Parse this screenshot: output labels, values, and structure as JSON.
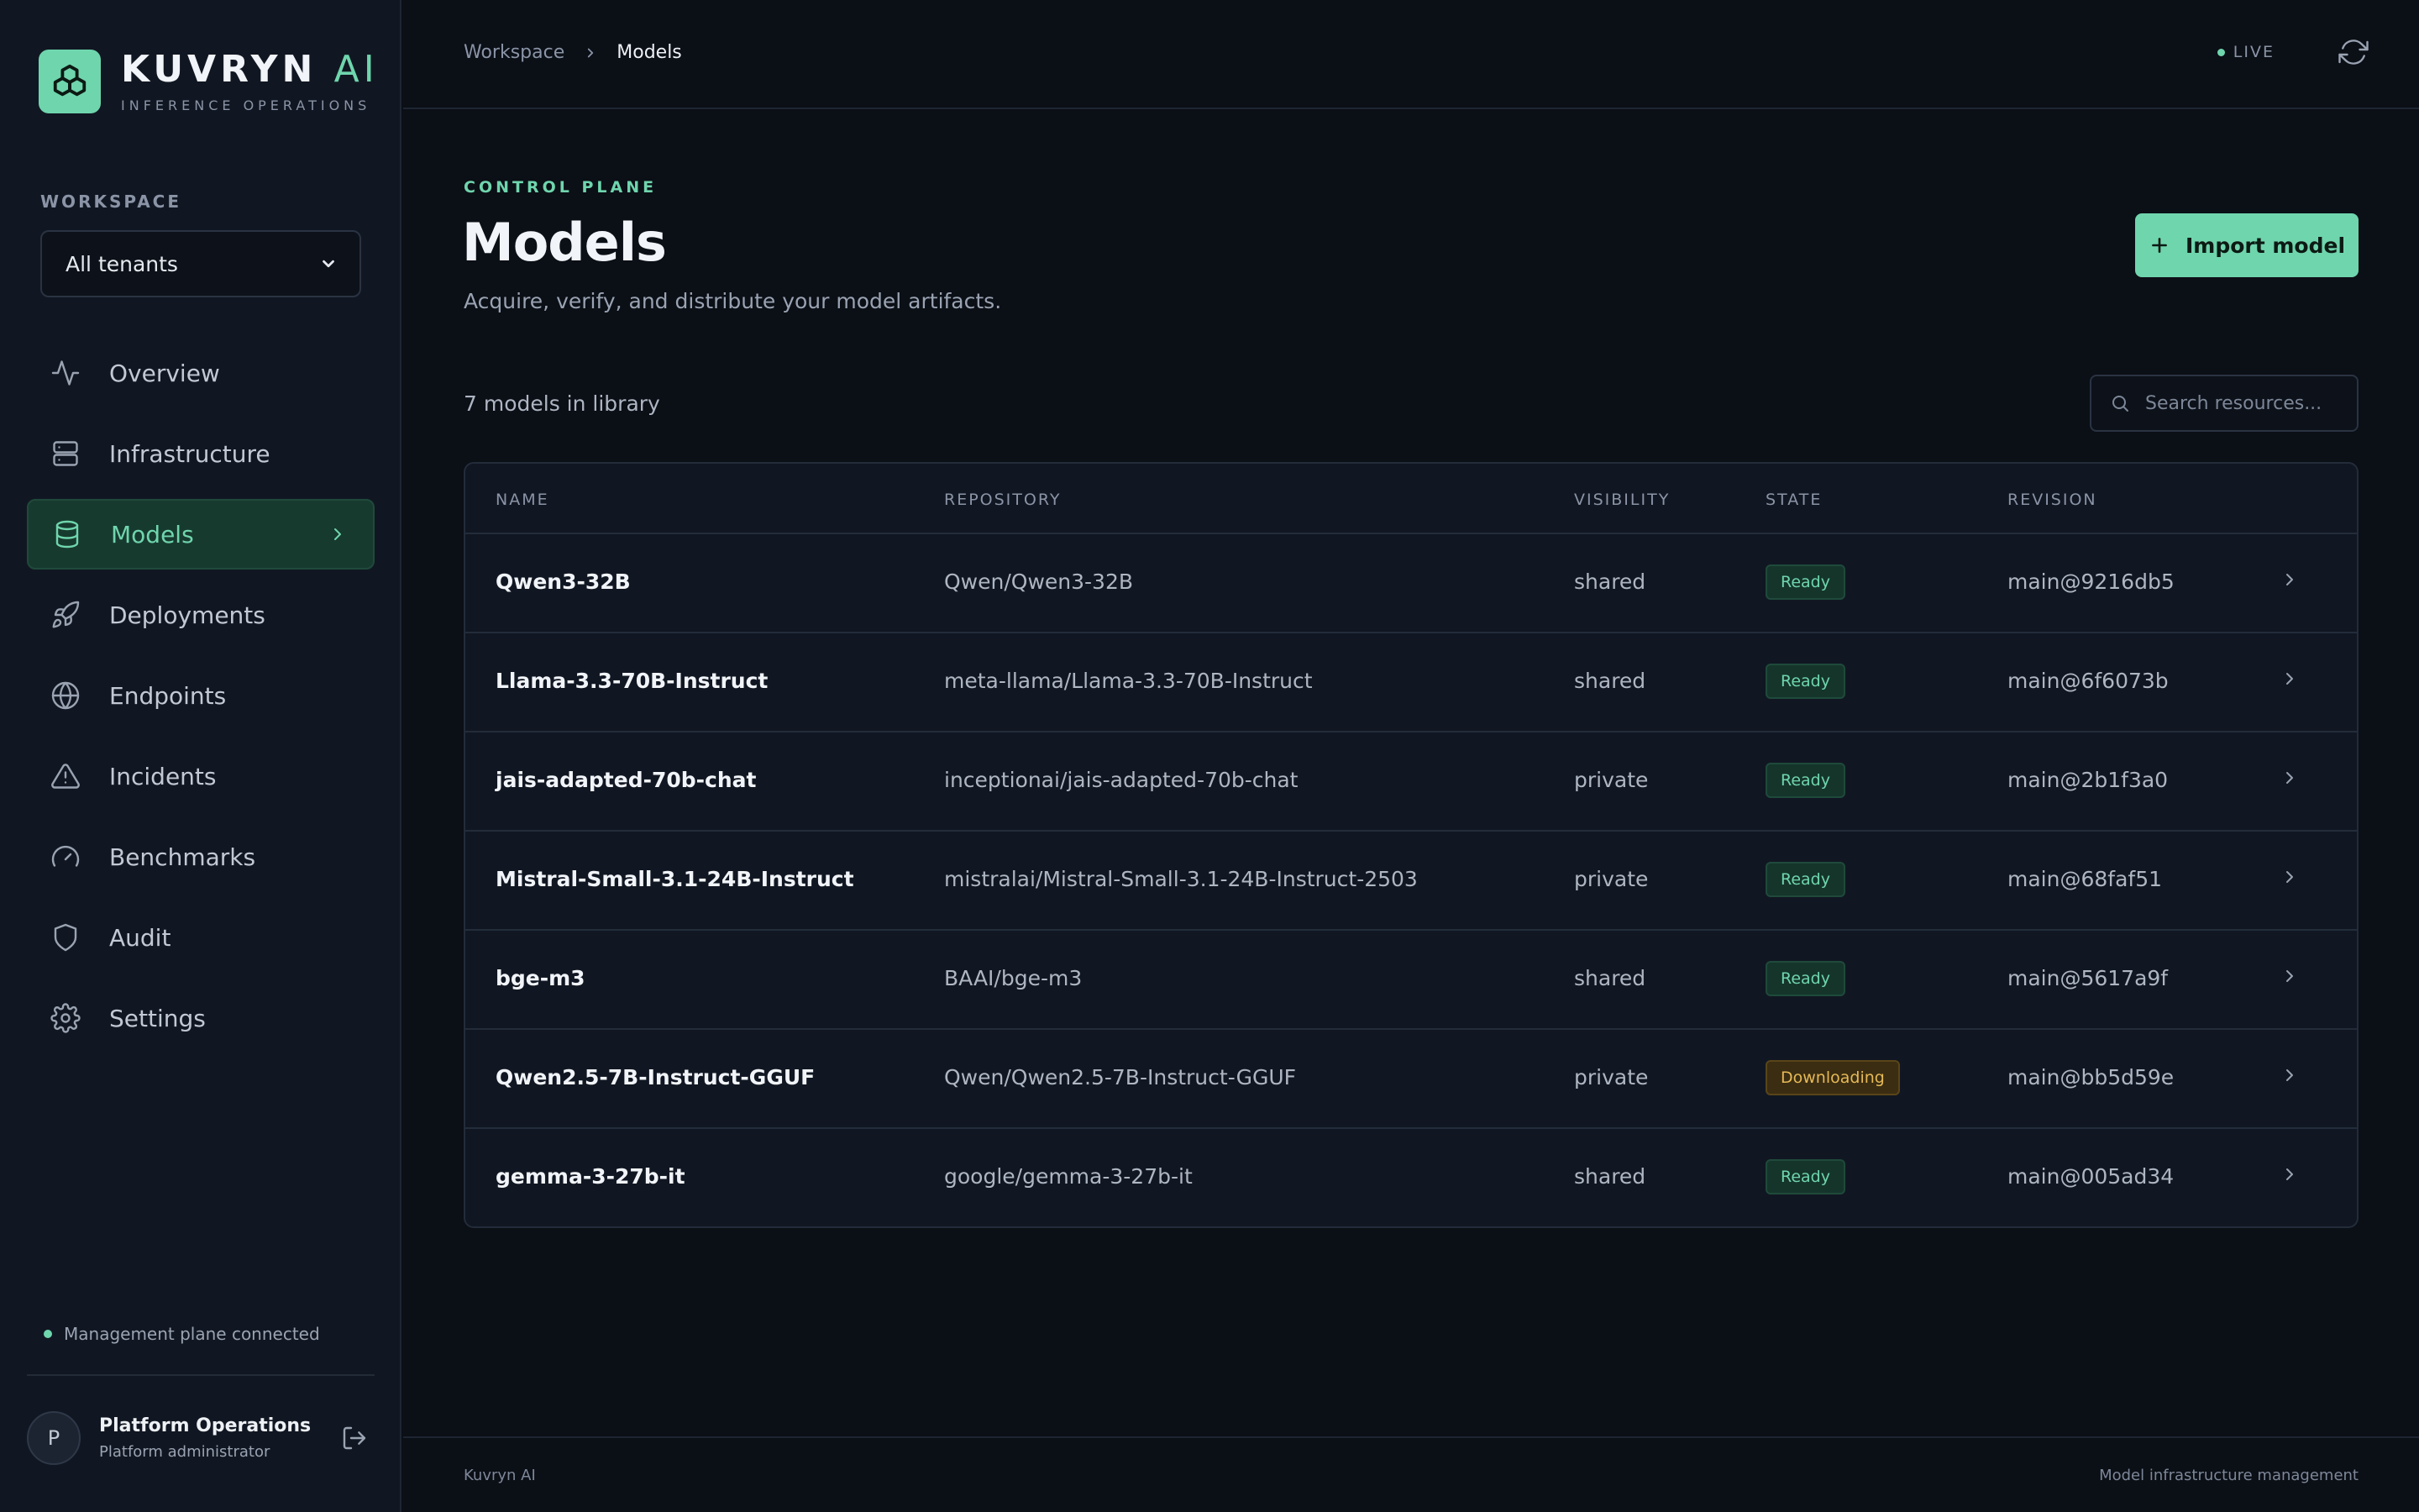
{
  "brand": {
    "name": "KUVRYN",
    "name_accent": "AI",
    "subtitle": "INFERENCE OPERATIONS"
  },
  "sidebar": {
    "workspace_label": "WORKSPACE",
    "workspace_value": "All tenants",
    "items": [
      {
        "label": "Overview",
        "icon": "activity-icon"
      },
      {
        "label": "Infrastructure",
        "icon": "server-icon"
      },
      {
        "label": "Models",
        "icon": "database-icon",
        "active": true
      },
      {
        "label": "Deployments",
        "icon": "rocket-icon"
      },
      {
        "label": "Endpoints",
        "icon": "globe-icon"
      },
      {
        "label": "Incidents",
        "icon": "alert-triangle-icon"
      },
      {
        "label": "Benchmarks",
        "icon": "gauge-icon"
      },
      {
        "label": "Audit",
        "icon": "shield-icon"
      },
      {
        "label": "Settings",
        "icon": "gear-icon"
      }
    ],
    "connection_status": "Management plane connected",
    "user": {
      "initial": "P",
      "name": "Platform Operations",
      "role": "Platform administrator"
    }
  },
  "topbar": {
    "breadcrumb": [
      "Workspace",
      "Models"
    ],
    "live_label": "LIVE"
  },
  "main": {
    "eyebrow": "CONTROL PLANE",
    "title": "Models",
    "subtitle": "Acquire, verify, and distribute your model artifacts.",
    "import_label": "Import model",
    "count_label": "7 models in library",
    "search_placeholder": "Search resources..."
  },
  "table": {
    "columns": [
      "NAME",
      "REPOSITORY",
      "VISIBILITY",
      "STATE",
      "REVISION"
    ],
    "rows": [
      {
        "name": "Qwen3-32B",
        "repo": "Qwen/Qwen3-32B",
        "visibility": "shared",
        "state": "Ready",
        "revision": "main@9216db5"
      },
      {
        "name": "Llama-3.3-70B-Instruct",
        "repo": "meta-llama/Llama-3.3-70B-Instruct",
        "visibility": "shared",
        "state": "Ready",
        "revision": "main@6f6073b"
      },
      {
        "name": "jais-adapted-70b-chat",
        "repo": "inceptionai/jais-adapted-70b-chat",
        "visibility": "private",
        "state": "Ready",
        "revision": "main@2b1f3a0"
      },
      {
        "name": "Mistral-Small-3.1-24B-Instruct",
        "repo": "mistralai/Mistral-Small-3.1-24B-Instruct-2503",
        "visibility": "private",
        "state": "Ready",
        "revision": "main@68faf51"
      },
      {
        "name": "bge-m3",
        "repo": "BAAI/bge-m3",
        "visibility": "shared",
        "state": "Ready",
        "revision": "main@5617a9f"
      },
      {
        "name": "Qwen2.5-7B-Instruct-GGUF",
        "repo": "Qwen/Qwen2.5-7B-Instruct-GGUF",
        "visibility": "private",
        "state": "Downloading",
        "revision": "main@bb5d59e"
      },
      {
        "name": "gemma-3-27b-it",
        "repo": "google/gemma-3-27b-it",
        "visibility": "shared",
        "state": "Ready",
        "revision": "main@005ad34"
      }
    ]
  },
  "footer": {
    "left": "Kuvryn AI",
    "right": "Model infrastructure management"
  },
  "colors": {
    "accent": "#6fd5ad",
    "background": "#0b0f16",
    "sidebar": "#111722",
    "ready": "#6fd5ad",
    "downloading": "#e6b957"
  }
}
